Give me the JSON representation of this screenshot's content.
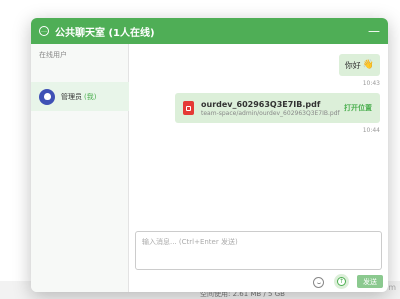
{
  "background": {
    "storage_text": "空间使用: 2.61 MB / 5 GB",
    "corner_tag": "edu.com"
  },
  "chat": {
    "title": "公共聊天室 (1人在线)",
    "minimize_label": "—",
    "header_icon": "chat-bubble-icon",
    "accent_color": "#4fae56"
  },
  "sidebar": {
    "title": "在线用户",
    "users": [
      {
        "name": "管理员",
        "tag": "(我)",
        "avatar_icon": "user-icon"
      }
    ]
  },
  "messages": {
    "text_message": {
      "text": "你好",
      "emoji": "👋",
      "time": "10:43"
    },
    "file_message": {
      "file_name": "ourdev_602963Q3E7IB.pdf",
      "file_path": "team-space/admin/ourdev_602963Q3E7IB.pdf",
      "open_label": "打开位置",
      "time": "10:44",
      "file_icon": "pdf-icon"
    }
  },
  "input": {
    "placeholder": "输入消息... (Ctrl+Enter 发送)",
    "value": "",
    "send_label": "发送",
    "emoji_icon": "smiley-icon",
    "upload_icon": "upload-icon",
    "upload_glyph": "↑"
  }
}
